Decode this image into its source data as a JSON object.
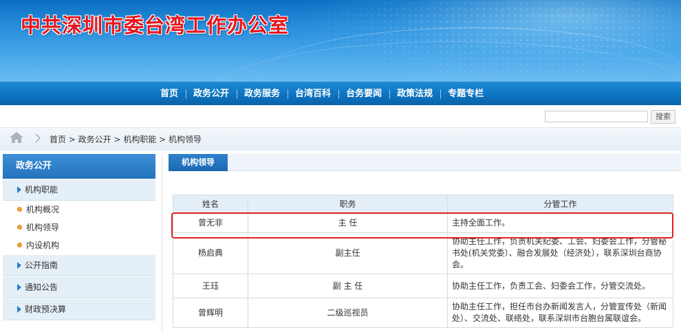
{
  "site": {
    "title": "中共深圳市委台湾工作办公室"
  },
  "nav": [
    "首页",
    "政务公开",
    "政务服务",
    "台湾百科",
    "台务要闻",
    "政策法规",
    "专题专栏"
  ],
  "search": {
    "placeholder": "",
    "button": "搜索"
  },
  "breadcrumb": "首页 > 政务公开 > 机构职能 > 机构领导",
  "sidebar": {
    "heading": "政务公开",
    "sections": [
      {
        "label": "机构职能",
        "sub": [
          "机构概况",
          "机构领导",
          "内设机构"
        ]
      },
      {
        "label": "公开指南"
      },
      {
        "label": "通知公告"
      },
      {
        "label": "财政预决算"
      }
    ]
  },
  "content": {
    "tab": "机构领导",
    "table": {
      "headers": [
        "姓名",
        "职务",
        "分管工作"
      ],
      "rows": [
        [
          "曾无非",
          "主 任",
          "主持全面工作。"
        ],
        [
          "杨启典",
          "副主任",
          "协助主任工作，负责机关纪委、工会、妇委会工作，分管秘书处(机关党委）、融合发展处（经济处），联系深圳台商协会。"
        ],
        [
          "王珏",
          "副 主 任",
          "协助主任工作，负责工会、妇委会工作，分管交流处。"
        ],
        [
          "曾辉明",
          "二级巡视员",
          "协助主任工作，担任市台办新闻发言人，分管宣传处（新闻处）、交流处、联络处，联系深圳市台胞台属联谊会。"
        ]
      ]
    }
  },
  "colors": {
    "brand_red": "#e8141c",
    "nav_blue": "#0d73c0",
    "highlight": "#e0201c"
  }
}
